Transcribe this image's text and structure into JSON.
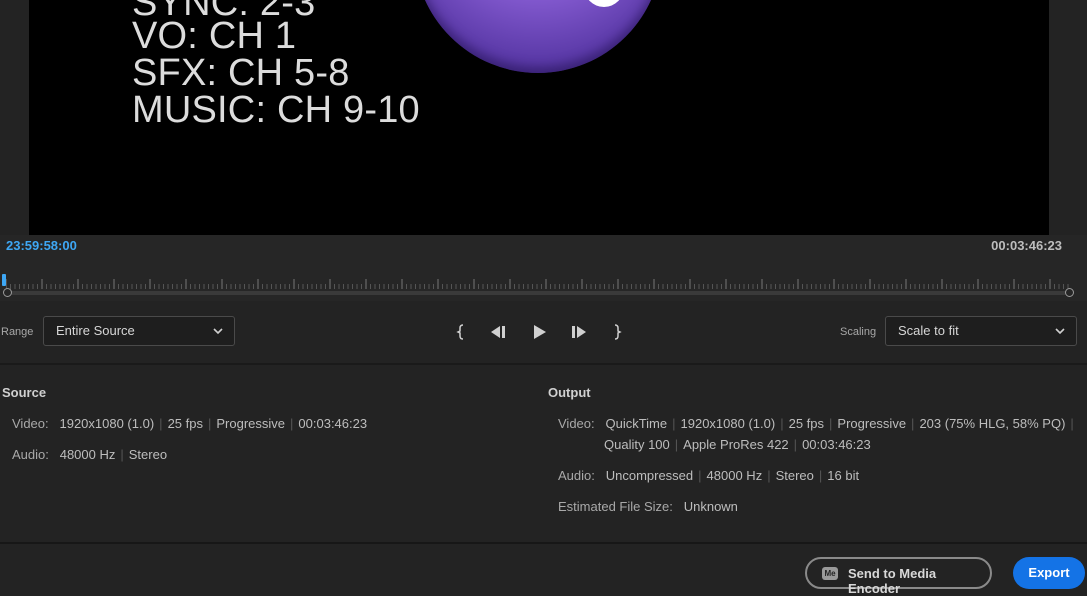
{
  "preview": {
    "lines": [
      "SYNC: 2-3",
      "VO: CH 1",
      "SFX: CH 5-8",
      "MUSIC: CH 9-10"
    ]
  },
  "timeline": {
    "in_timecode": "23:59:58:00",
    "duration_timecode": "00:03:46:23"
  },
  "controls": {
    "range_label": "Range",
    "range_value": "Entire Source",
    "scaling_label": "Scaling",
    "scaling_value": "Scale to fit",
    "transport_icons": [
      "mark-in-icon",
      "step-back-icon",
      "play-icon",
      "step-forward-icon",
      "mark-out-icon"
    ]
  },
  "source": {
    "title": "Source",
    "video_label": "Video:",
    "video_values": [
      "1920x1080 (1.0)",
      "25 fps",
      "Progressive",
      "00:03:46:23"
    ],
    "audio_label": "Audio:",
    "audio_values": [
      "48000 Hz",
      "Stereo"
    ]
  },
  "output": {
    "title": "Output",
    "video_label": "Video:",
    "video_values_line1": [
      "QuickTime",
      "1920x1080 (1.0)",
      "25 fps",
      "Progressive",
      "203 (75% HLG, 58% PQ)"
    ],
    "video_values_line2": [
      "Quality 100",
      "Apple ProRes 422",
      "00:03:46:23"
    ],
    "audio_label": "Audio:",
    "audio_values": [
      "Uncompressed",
      "48000 Hz",
      "Stereo",
      "16 bit"
    ],
    "size_label": "Estimated File Size:",
    "size_value": "Unknown"
  },
  "footer": {
    "media_encoder_icon": "Me",
    "send_label": "Send to Media Encoder",
    "export_label": "Export"
  },
  "colors": {
    "accent": "#1473e6",
    "timecode_active": "#3ea7f4",
    "background": "#232323"
  }
}
